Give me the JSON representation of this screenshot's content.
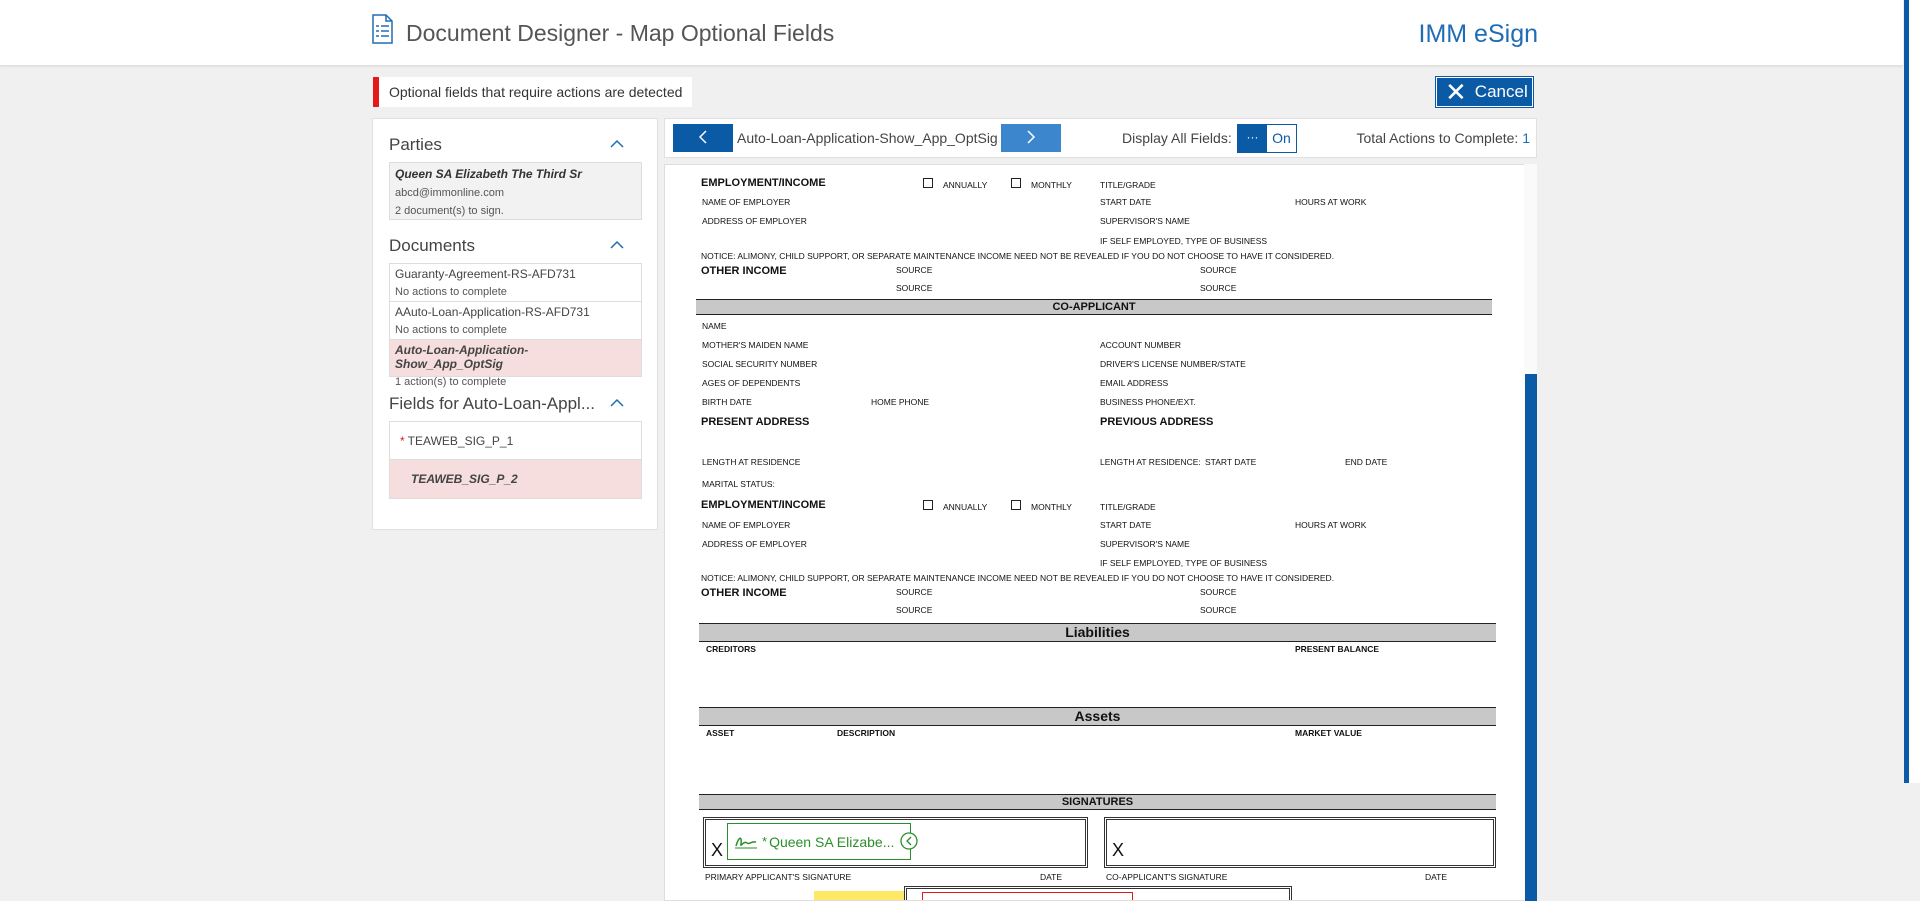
{
  "header": {
    "title": "Document Designer - Map Optional Fields",
    "brand": "IMM eSign"
  },
  "alert": {
    "message": "Optional fields that require actions are detected"
  },
  "toolbar": {
    "cancel_label": "Cancel"
  },
  "parties": {
    "title": "Parties",
    "items": [
      {
        "name": "Queen SA Elizabeth The Third Sr",
        "email": "abcd@immonline.com",
        "docs": "2 document(s) to sign."
      }
    ]
  },
  "documents": {
    "title": "Documents",
    "items": [
      {
        "name": "Guaranty-Agreement-RS-AFD731",
        "status": "No actions to complete"
      },
      {
        "name": "AAuto-Loan-Application-RS-AFD731",
        "status": "No actions to complete"
      },
      {
        "name": "Auto-Loan-Application-Show_App_OptSig",
        "status": "1 action(s) to complete"
      }
    ]
  },
  "fields": {
    "title": "Fields for Auto-Loan-Appl...",
    "items": [
      {
        "name": "TEAWEB_SIG_P_1",
        "required": "*"
      },
      {
        "name": "TEAWEB_SIG_P_2"
      }
    ]
  },
  "nav": {
    "current_doc": "Auto-Loan-Application-Show_App_OptSig",
    "display_all_label": "Display All Fields:",
    "toggle_knob": "···",
    "toggle_state": "On",
    "total_label": "Total Actions to Complete:",
    "total_value": "1"
  },
  "form": {
    "employment": "EMPLOYMENT/INCOME",
    "annually": "ANNUALLY",
    "monthly": "MONTHLY",
    "title_grade": "TITLE/GRADE",
    "name_of_employer": "NAME OF EMPLOYER",
    "start_date": "START DATE",
    "hours_at_work": "HOURS AT WORK",
    "address_of_employer": "ADDRESS OF EMPLOYER",
    "supervisor": "SUPERVISOR'S NAME",
    "self_employed": "IF SELF EMPLOYED, TYPE OF BUSINESS",
    "notice": "NOTICE: ALIMONY, CHILD SUPPORT, OR SEPARATE MAINTENANCE INCOME NEED NOT BE REVEALED IF YOU DO NOT CHOOSE TO HAVE IT CONSIDERED.",
    "other_income": "OTHER INCOME",
    "source": "SOURCE",
    "co_applicant": "CO-APPLICANT",
    "name": "NAME",
    "maiden_name": "MOTHER'S MAIDEN NAME",
    "account_number": "ACCOUNT NUMBER",
    "ssn": "SOCIAL SECURITY NUMBER",
    "drivers_license": "DRIVER'S LICENSE NUMBER/STATE",
    "dependents": "AGES OF DEPENDENTS",
    "email_address": "EMAIL ADDRESS",
    "birth_date": "BIRTH DATE",
    "home_phone": "HOME PHONE",
    "business_phone": "BUSINESS PHONE/EXT.",
    "present_address": "PRESENT ADDRESS",
    "previous_address": "PREVIOUS ADDRESS",
    "length_residence": "LENGTH AT RESIDENCE",
    "length_residence2": "LENGTH AT RESIDENCE:",
    "end_date": "END DATE",
    "marital_status": "MARITAL STATUS:",
    "liabilities": "Liabilities",
    "creditors": "CREDITORS",
    "present_balance": "PRESENT BALANCE",
    "assets": "Assets",
    "asset": "ASSET",
    "description": "DESCRIPTION",
    "market_value": "MARKET VALUE",
    "signatures": "SIGNATURES",
    "x_mark": "X",
    "sig_field_label": "Queen SA Elizabe...",
    "sig_required": "*",
    "primary_sig": "PRIMARY APPLICANT'S SIGNATURE",
    "date": "DATE",
    "co_sig": "CO-APPLICANT'S SIGNATURE"
  },
  "colors": {
    "accent": "#0b5aa6",
    "alert": "#e21a1a",
    "active_row": "#f6dede",
    "sig_field": "#2a8f2a"
  }
}
